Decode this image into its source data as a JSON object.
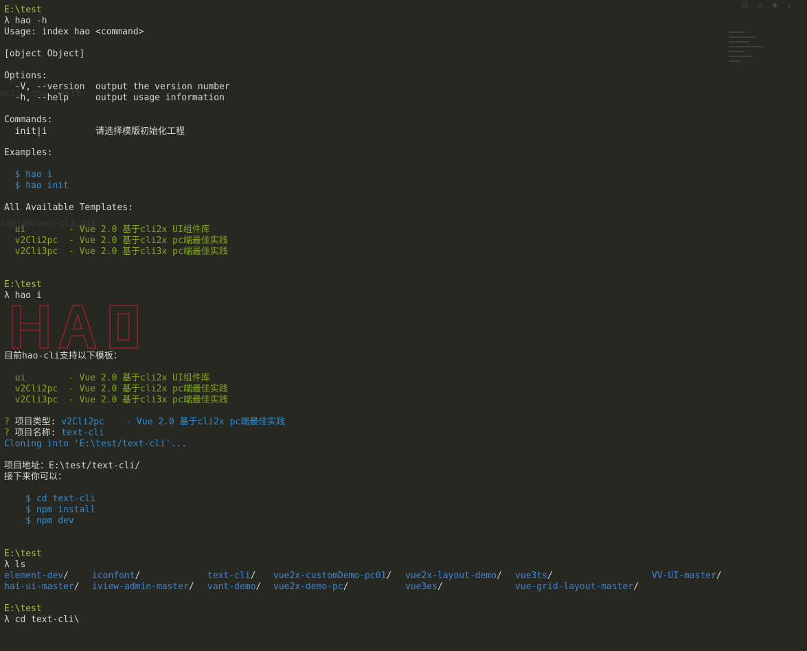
{
  "background_color": "#272822",
  "colors": {
    "path": "#a6c93a",
    "text": "#d8d8d2",
    "command_example": "#2e8fd6",
    "template": "#86a81b",
    "directory": "#3d86d8",
    "banner": "#a6232b"
  },
  "block1": {
    "path": "E:\\test",
    "prompt": "λ hao -h",
    "usage": "Usage: index hao <command>",
    "object": "[object Object]",
    "options_header": "Options:",
    "option_version": "  -V, --version  output the version number",
    "option_help": "  -h, --help     output usage information",
    "commands_header": "Commands:",
    "command_init": "  init|i         请选择模版初始化工程",
    "examples_header": "Examples:",
    "example1": "  $ hao i",
    "example2": "  $ hao init",
    "templates_header": "All Available Templates:",
    "tpl1": "  ui        - Vue 2.0 基于cli2x UI组件库",
    "tpl2": "  v2Cli2pc  - Vue 2.0 基于cli2x pc端最佳实践",
    "tpl3": "  v2Cli3pc  - Vue 2.0 基于cli3x pc端最佳实践"
  },
  "block2": {
    "path": "E:\\test",
    "prompt": "λ hao i",
    "banner_text": "HAO",
    "support_text": "目前hao-cli支持以下模板：",
    "tpl1": "  ui        - Vue 2.0 基于cli2x UI组件库",
    "tpl2": "  v2Cli2pc  - Vue 2.0 基于cli2x pc端最佳实践",
    "tpl3": "  v2Cli3pc  - Vue 2.0 基于cli3x pc端最佳实践",
    "q1_mark": "?",
    "q1_label": " 项目类型: ",
    "q1_value": "v2Cli2pc    - Vue 2.0 基于cli2x pc端最佳实践",
    "q2_mark": "?",
    "q2_label": " 项目名称: ",
    "q2_value": "text-cli",
    "cloning": "Cloning into 'E:\\test/text-cli'...",
    "address": "项目地址：E:\\test/text-cli/",
    "next": "接下来你可以：",
    "step1": "    $ cd text-cli",
    "step2": "    $ npm install",
    "step3": "    $ npm dev"
  },
  "block3": {
    "path": "E:\\test",
    "prompt": "λ ls",
    "row1": [
      "element-dev",
      "iconfont",
      "text-cli",
      "vue2x-customDemo-pc01",
      "vue2x-layout-demo",
      "vue3ts",
      "VV-UI-master"
    ],
    "row2": [
      "hai-ui-master",
      "iview-admin-master",
      "vant-demo",
      "vue2x-demo-pc",
      "vue3es",
      "vue-grid-layout-master"
    ],
    "slash": "/"
  },
  "block4": {
    "path": "E:\\test",
    "prompt": "λ cd text-cli\\"
  },
  "ghost": {
    "text1": "ecli  doc  exit",
    "text2": "iaojun/hao-cli.git\""
  }
}
